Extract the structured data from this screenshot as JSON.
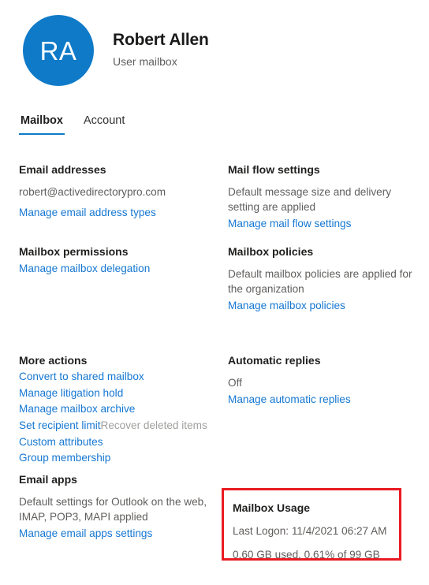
{
  "header": {
    "avatar_initials": "RA",
    "display_name": "Robert Allen",
    "mailbox_type": "User mailbox",
    "avatar_color": "#0f7ac8"
  },
  "tabs": [
    {
      "label": "Mailbox",
      "active": true
    },
    {
      "label": "Account",
      "active": false
    }
  ],
  "accent_color": "#1577d2",
  "highlight_color": "#ea1b22",
  "left_column": {
    "email_addresses": {
      "title": "Email addresses",
      "value": "robert@activedirectorypro.com",
      "link": "Manage email address types"
    },
    "mailbox_permissions": {
      "title": "Mailbox permissions",
      "link": "Manage mailbox delegation"
    },
    "more_actions": {
      "title": "More actions",
      "links": [
        "Convert to shared mailbox",
        "Manage litigation hold",
        "Manage mailbox archive"
      ],
      "inline_link": "Set recipient limit",
      "inline_disabled": "Recover deleted items",
      "links_after": [
        "Custom attributes",
        "Group membership"
      ]
    },
    "email_apps": {
      "title": "Email apps",
      "description": "Default settings for Outlook on the web, IMAP, POP3, MAPI applied",
      "link": "Manage email apps settings"
    }
  },
  "right_column": {
    "mail_flow_settings": {
      "title": "Mail flow settings",
      "description": "Default message size and delivery setting are applied",
      "link": "Manage mail flow settings"
    },
    "mailbox_policies": {
      "title": "Mailbox policies",
      "description": "Default mailbox policies are applied for the organization",
      "link": "Manage mailbox policies"
    },
    "automatic_replies": {
      "title": "Automatic replies",
      "status": "Off",
      "link": "Manage automatic replies"
    },
    "mailbox_usage": {
      "title": "Mailbox Usage",
      "last_logon": "Last Logon: 11/4/2021 06:27 AM",
      "quota": "0.60 GB used, 0.61% of 99 GB"
    }
  }
}
